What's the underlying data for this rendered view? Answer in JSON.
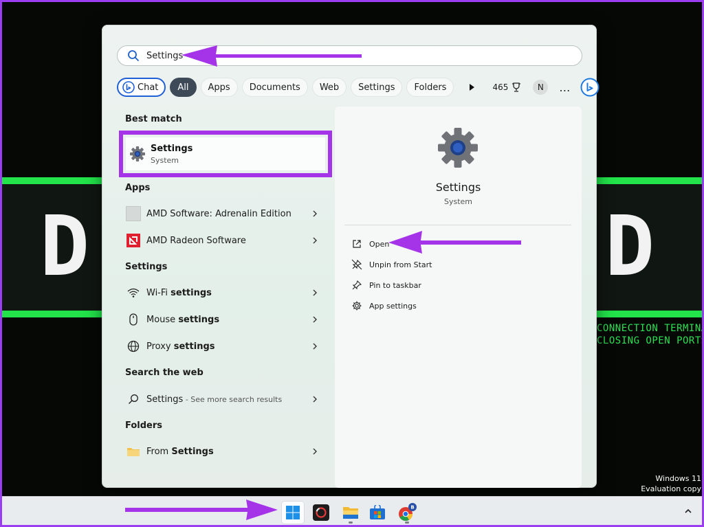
{
  "desktop": {
    "letter_left": "D",
    "letter_right": "D",
    "terminal_lines": [
      "CONNECTION TERMINAT",
      "CLOSING OPEN PORTS"
    ],
    "watermark": [
      "Windows 11",
      "Evaluation copy"
    ]
  },
  "search": {
    "value": "Settings"
  },
  "filters": {
    "chat": "Chat",
    "items": [
      "All",
      "Apps",
      "Documents",
      "Web",
      "Settings",
      "Folders"
    ],
    "active": "All",
    "points": "465",
    "avatar_initial": "N",
    "more": "…"
  },
  "sections": {
    "best_match": "Best match",
    "apps": "Apps",
    "settings": "Settings",
    "search_web": "Search the web",
    "folders": "Folders"
  },
  "best_match": {
    "title": "Settings",
    "subtitle": "System"
  },
  "apps": [
    {
      "label": "AMD Software: Adrenalin Edition"
    },
    {
      "label": "AMD Radeon Software"
    }
  ],
  "settings_items": [
    {
      "pre": "Wi-Fi ",
      "bold": "settings"
    },
    {
      "pre": "Mouse ",
      "bold": "settings"
    },
    {
      "pre": "Proxy ",
      "bold": "settings"
    }
  ],
  "web": {
    "label": "Settings",
    "suffix": " - See more search results"
  },
  "folders": {
    "pre": "From ",
    "bold": "Settings"
  },
  "preview": {
    "title": "Settings",
    "subtitle": "System",
    "actions": [
      "Open",
      "Unpin from Start",
      "Pin to taskbar",
      "App settings"
    ]
  },
  "colors": {
    "accent": "#a533e8",
    "taskbar": "#e9ecef",
    "active_pill": "#3e4a58"
  }
}
